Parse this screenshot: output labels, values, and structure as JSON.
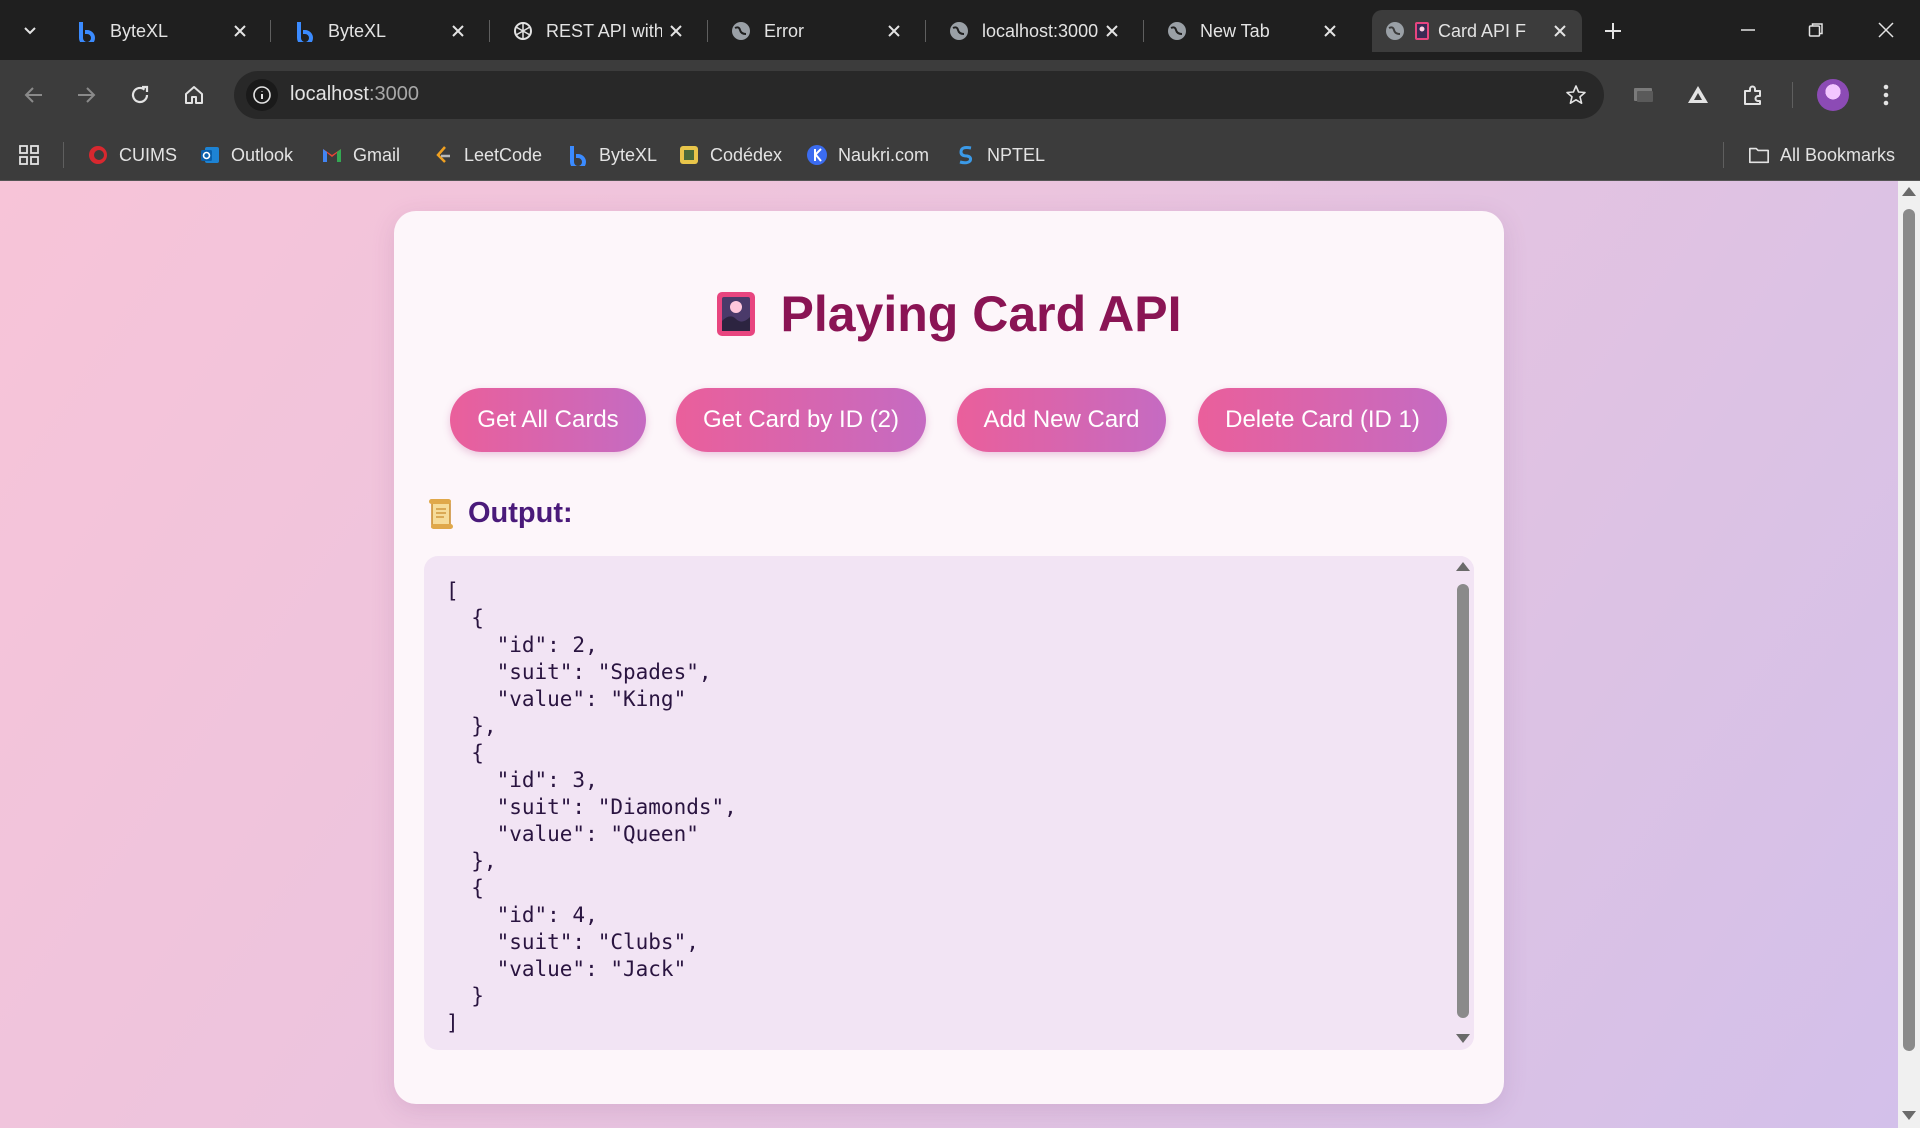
{
  "browser": {
    "tabs": [
      {
        "title": "ByteXL",
        "favicon": "bytexl-icon"
      },
      {
        "title": "ByteXL",
        "favicon": "bytexl-icon"
      },
      {
        "title": "REST API with",
        "favicon": "openai-icon"
      },
      {
        "title": "Error",
        "favicon": "globe-icon"
      },
      {
        "title": "localhost:3000",
        "favicon": "globe-icon"
      },
      {
        "title": "New Tab",
        "favicon": "globe-icon"
      },
      {
        "title": "Card API F",
        "favicon": "playing-card-icon",
        "active": true
      }
    ],
    "address": {
      "host": "localhost",
      "port": ":3000"
    },
    "bookmarks": [
      {
        "label": "CUIMS"
      },
      {
        "label": "Outlook"
      },
      {
        "label": "Gmail"
      },
      {
        "label": "LeetCode"
      },
      {
        "label": "ByteXL"
      },
      {
        "label": "Codédex"
      },
      {
        "label": "Naukri.com"
      },
      {
        "label": "NPTEL"
      }
    ],
    "all_bookmarks": "All Bookmarks"
  },
  "app": {
    "title": "Playing Card API",
    "buttons": {
      "get_all": "Get All Cards",
      "get_by_id": "Get Card by ID (2)",
      "add": "Add New Card",
      "delete": "Delete Card (ID 1)"
    },
    "output_label": "Output:",
    "output_text": "[\n  {\n    \"id\": 2,\n    \"suit\": \"Spades\",\n    \"value\": \"King\"\n  },\n  {\n    \"id\": 3,\n    \"suit\": \"Diamonds\",\n    \"value\": \"Queen\"\n  },\n  {\n    \"id\": 4,\n    \"suit\": \"Clubs\",\n    \"value\": \"Jack\"\n  }\n]"
  },
  "colors": {
    "accent_start": "#ea5f9b",
    "accent_end": "#c56bc2",
    "title": "#8a1454",
    "output_label": "#4a1a7a"
  }
}
